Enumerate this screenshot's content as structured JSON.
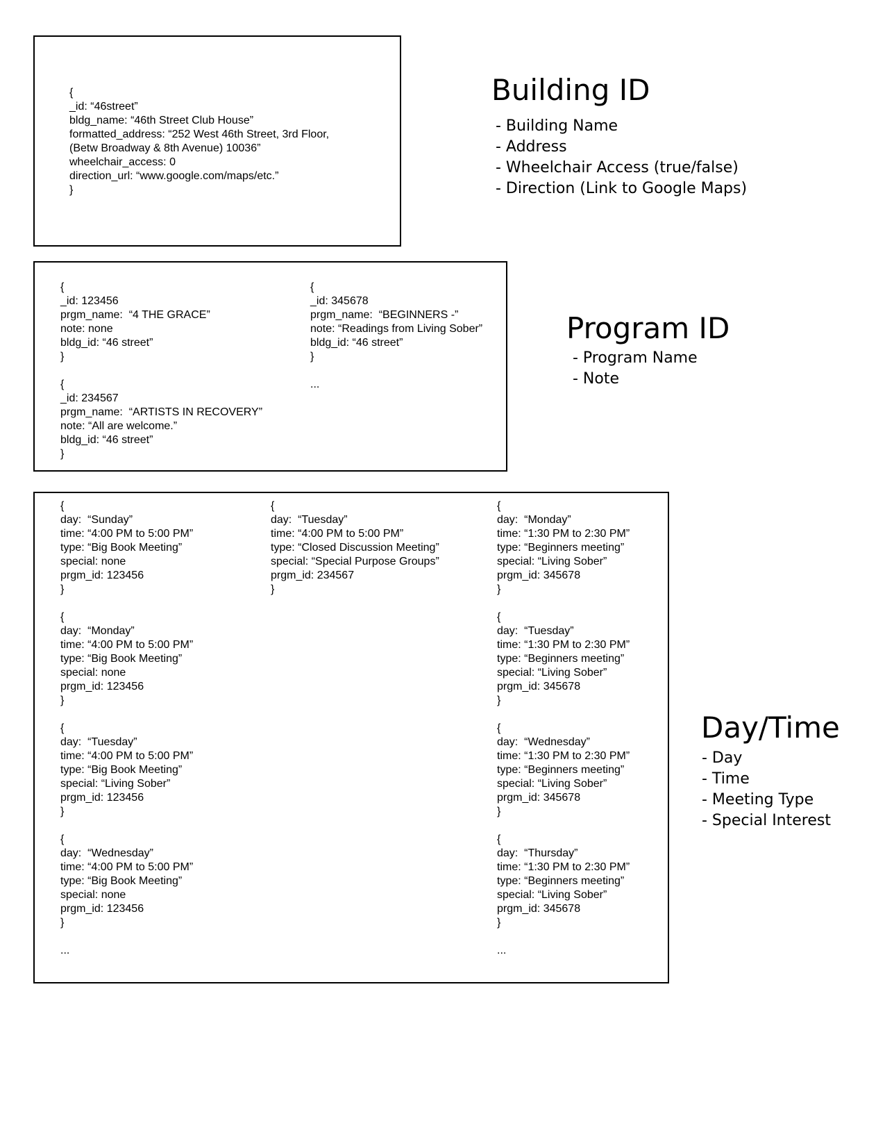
{
  "building": {
    "record": "{\n_id: “46street”\nbldg_name: “46th Street Club House”\nformatted_address: “252 West 46th Street, 3rd Floor,\n(Betw Broadway & 8th Avenue) 10036”\nwheelchair_access: 0\ndirection_url: “www.google.com/maps/etc.”\n}",
    "heading": "Building ID",
    "fields": [
      "- Building Name",
      "- Address",
      "- Wheelchair Access (true/false)",
      "- Direction (Link to Google Maps)"
    ]
  },
  "program": {
    "left": "{\n_id: 123456\nprgm_name:  “4 THE GRACE”\nnote: none\nbldg_id: “46 street”\n}\n\n{\n_id: 234567\nprgm_name:  “ARTISTS IN RECOVERY”\nnote: “All are welcome.”\nbldg_id: “46 street”\n}",
    "right": "{\n_id: 345678\nprgm_name:  “BEGINNERS -”\nnote: “Readings from Living Sober”\nbldg_id: “46 street”\n}\n\n...",
    "heading": "Program ID",
    "fields": [
      "- Program Name",
      "- Note"
    ]
  },
  "daytime": {
    "col1": "{\nday:  “Sunday”\ntime: “4:00 PM to 5:00 PM”\ntype: “Big Book Meeting”\nspecial: none\nprgm_id: 123456\n}\n\n{\nday:  “Monday”\ntime: “4:00 PM to 5:00 PM”\ntype: “Big Book Meeting”\nspecial: none\nprgm_id: 123456\n}\n\n{\nday:  “Tuesday”\ntime: “4:00 PM to 5:00 PM”\ntype: “Big Book Meeting”\nspecial: “Living Sober”\nprgm_id: 123456\n}\n\n{\nday:  “Wednesday”\ntime: “4:00 PM to 5:00 PM”\ntype: “Big Book Meeting”\nspecial: none\nprgm_id: 123456\n}\n\n...",
    "col2": "{\nday:  “Tuesday”\ntime: “4:00 PM to 5:00 PM”\ntype: “Closed Discussion Meeting”\nspecial: “Special Purpose Groups”\nprgm_id: 234567\n}",
    "col3": "{\nday:  “Monday”\ntime: “1:30 PM to 2:30 PM”\ntype: “Beginners meeting”\nspecial: “Living Sober”\nprgm_id: 345678\n}\n\n{\nday:  “Tuesday”\ntime: “1:30 PM to 2:30 PM”\ntype: “Beginners meeting”\nspecial: “Living Sober”\nprgm_id: 345678\n}\n\n{\nday:  “Wednesday”\ntime: “1:30 PM to 2:30 PM”\ntype: “Beginners meeting”\nspecial: “Living Sober”\nprgm_id: 345678\n}\n\n{\nday:  “Thursday”\ntime: “1:30 PM to 2:30 PM”\ntype: “Beginners meeting”\nspecial: “Living Sober”\nprgm_id: 345678\n}\n\n...",
    "heading": "Day/Time",
    "fields": [
      "- Day",
      "- Time",
      "- Meeting Type",
      "- Special Interest"
    ]
  }
}
